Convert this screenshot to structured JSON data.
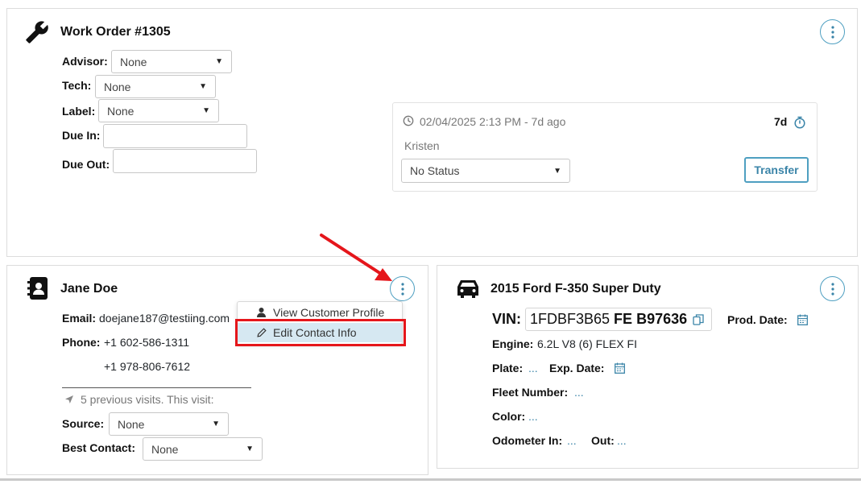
{
  "work_order": {
    "title": "Work Order #1305",
    "advisor_label": "Advisor:",
    "advisor_value": "None",
    "tech_label": "Tech:",
    "tech_value": "None",
    "label_label": "Label:",
    "label_value": "None",
    "due_in_label": "Due In:",
    "due_in_value": "",
    "due_out_label": "Due Out:",
    "due_out_value": "",
    "status": {
      "timestamp": "02/04/2025 2:13 PM - 7d ago",
      "age": "7d",
      "person": "Kristen",
      "status_value": "No Status",
      "transfer_label": "Transfer"
    }
  },
  "customer": {
    "name": "Jane Doe",
    "email_label": "Email:",
    "email_value": "doejane187@testiing.com",
    "phone_label": "Phone:",
    "phone_1": "+1 602-586-1311",
    "phone_2": "+1 978-806-7612",
    "visits_text": "5 previous visits. This visit:",
    "source_label": "Source:",
    "source_value": "None",
    "best_contact_label": "Best Contact:",
    "best_contact_value": "None",
    "menu": {
      "view_profile": "View Customer Profile",
      "edit_contact": "Edit Contact Info"
    }
  },
  "vehicle": {
    "title": "2015 Ford F-350 Super Duty",
    "vin_label": "VIN:",
    "vin_prefix": "1FDBF3B65 ",
    "vin_bold_1": "FE",
    "vin_bold_2": " B97636",
    "prod_date_label": "Prod. Date:",
    "engine_label": "Engine:",
    "engine_value": "6.2L V8 (6) FLEX FI",
    "plate_label": "Plate:",
    "plate_value": "...",
    "exp_date_label": "Exp. Date:",
    "fleet_label": "Fleet Number:",
    "fleet_value": "...",
    "color_label": "Color:",
    "color_value": "...",
    "odometer_in_label": "Odometer In:",
    "odometer_in_value": "...",
    "out_label": "Out:",
    "out_value": "..."
  },
  "colors": {
    "accent": "#3a84a8",
    "highlight_box": "#e5161b",
    "arrow": "#e5161b",
    "menu_highlight": "#d6e8f2"
  }
}
